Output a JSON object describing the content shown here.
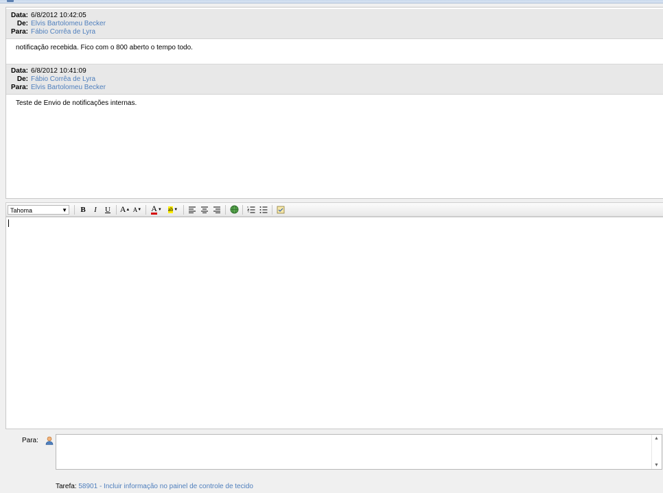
{
  "messages": [
    {
      "date_label": "Data:",
      "date": "6/8/2012 10:42:05",
      "from_label": "De:",
      "from": "Elvis Bartolomeu Becker",
      "to_label": "Para:",
      "to": "Fábio Corrêa de Lyra",
      "body": "notificação recebida. Fico com o 800 aberto o tempo todo."
    },
    {
      "date_label": "Data:",
      "date": "6/8/2012 10:41:09",
      "from_label": "De:",
      "from": "Fábio Corrêa de Lyra",
      "to_label": "Para:",
      "to": "Elvis Bartolomeu Becker",
      "body": "Teste de Envio de notificações internas."
    }
  ],
  "toolbar": {
    "font": "Tahoma",
    "bold": "B",
    "italic": "I",
    "underline": "U",
    "grow_font": "A",
    "shrink_font": "A",
    "font_color": "A",
    "highlight": "ab",
    "icons": [
      "bold-icon",
      "italic-icon",
      "underline-icon",
      "grow-font-icon",
      "shrink-font-icon",
      "font-color-icon",
      "highlight-icon",
      "align-left-icon",
      "align-center-icon",
      "align-right-icon",
      "insert-link-icon",
      "numbered-list-icon",
      "bullet-list-icon",
      "spellcheck-icon"
    ],
    "font_color_hex": "#d40000",
    "highlight_hex": "#ffee00"
  },
  "compose": {
    "recipient_label": "Para:",
    "recipient_value": "",
    "task_label": "Tarefa:",
    "task_link": "58901 - Incluir informação no painel de controle de tecido"
  },
  "colors": {
    "link": "#4f7fbd",
    "header_bg": "#e8e8e8"
  }
}
